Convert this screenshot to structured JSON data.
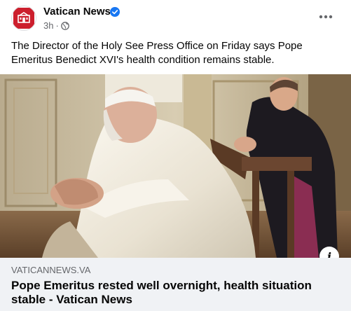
{
  "header": {
    "page_name": "Vatican News",
    "timestamp": "3h",
    "separator": "·",
    "audience_icon": "globe-icon",
    "verified_icon": "verified-badge-icon",
    "more_icon": "more-options-icon"
  },
  "post": {
    "text": "The Director of the Holy See Press Office on Friday says Pope Emeritus Benedict XVI's health condition remains stable."
  },
  "link_preview": {
    "domain": "VATICANNEWS.VA",
    "title": "Pope Emeritus rested well overnight, health situation stable - Vatican News",
    "info_icon": "info-icon",
    "info_glyph": "i"
  },
  "colors": {
    "brand": "#cc1f2d",
    "verified": "#1877f2",
    "secondary_text": "#65676b",
    "preview_bg": "#f0f2f5"
  }
}
